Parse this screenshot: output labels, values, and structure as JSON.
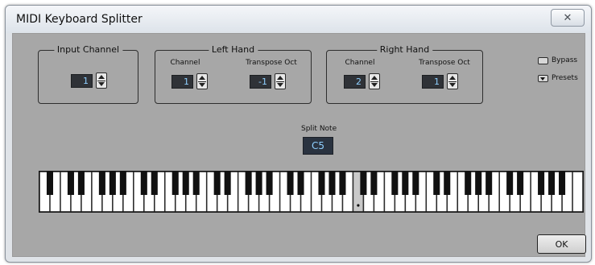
{
  "window": {
    "title": "MIDI Keyboard Splitter",
    "close_glyph": "✕"
  },
  "input_channel": {
    "title": "Input Channel",
    "value": "1"
  },
  "left_hand": {
    "title": "Left Hand",
    "channel_label": "Channel",
    "channel_value": "1",
    "transpose_label": "Transpose Oct",
    "transpose_value": "-1"
  },
  "right_hand": {
    "title": "Right Hand",
    "channel_label": "Channel",
    "channel_value": "2",
    "transpose_label": "Transpose Oct",
    "transpose_value": "1"
  },
  "options": {
    "bypass_label": "Bypass",
    "presets_label": "Presets"
  },
  "split": {
    "label": "Split Note",
    "value": "C5"
  },
  "keyboard": {
    "white_key_count": 52,
    "first_note": "A0",
    "split_note": "C5"
  },
  "ok_label": "OK",
  "colors": {
    "panel": "#a7a7a7",
    "value_text": "#8fd0ff",
    "value_bg": "#2f3237"
  }
}
